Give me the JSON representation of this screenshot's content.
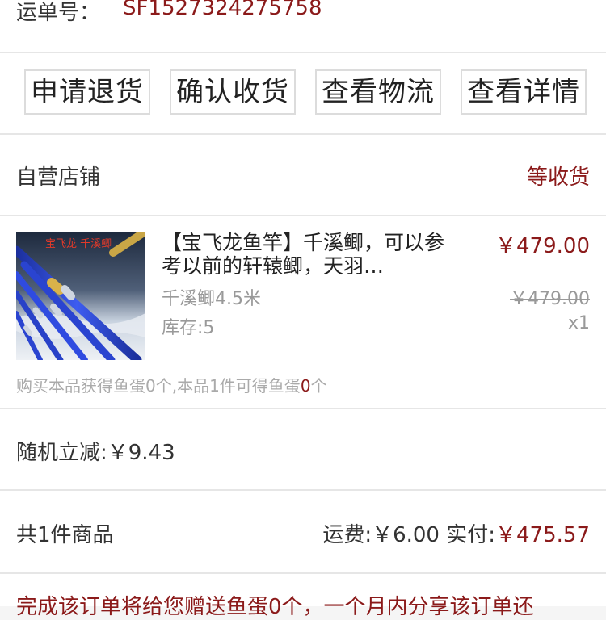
{
  "tracking": {
    "label": "运单号：",
    "number": "SF1527324275758"
  },
  "actions": [
    {
      "label": "申请退货"
    },
    {
      "label": "确认收货"
    },
    {
      "label": "查看物流"
    },
    {
      "label": "查看详情"
    }
  ],
  "store": {
    "name": "自营店铺",
    "status": "等收货"
  },
  "product": {
    "title": "【宝飞龙鱼竿】千溪鲫，可以参考以前的轩辕鲫，天羽…",
    "spec": "千溪鲫4.5米",
    "stock": "库存:5",
    "price_current": "￥479.00",
    "price_original": "￥479.00",
    "quantity": "x1",
    "image_text": "宝飞龙 千溪鲫",
    "reward_prefix": "购买本品获得鱼蛋0个,本品1件可得鱼蛋",
    "reward_highlight": "0",
    "reward_suffix": "个"
  },
  "discount": {
    "text": "随机立减:￥9.43"
  },
  "summary": {
    "item_count": "共1件商品",
    "shipping": "运费:￥6.00",
    "paid_label": "实付:",
    "paid_amount": "￥475.57"
  },
  "notice": {
    "text": "完成该订单将给您赠送鱼蛋0个，一个月内分享该订单还"
  },
  "colors": {
    "accent": "#8b1a1a",
    "border": "#dcdcdc",
    "muted": "#999999"
  }
}
